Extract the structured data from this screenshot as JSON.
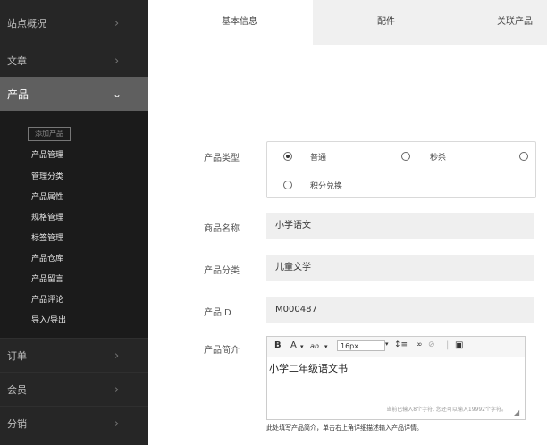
{
  "sidebar": {
    "top_items": [
      {
        "label": "站点概况",
        "icon": "chevron-right-icon"
      },
      {
        "label": "文章",
        "icon": "chevron-right-icon"
      }
    ],
    "active": {
      "label": "产品",
      "icon": "chevron-down-icon"
    },
    "sub_add": "添加产品",
    "sub_items": [
      "产品管理",
      "管理分类",
      "产品属性",
      "规格管理",
      "标签管理",
      "产品仓库",
      "产品留言",
      "产品评论",
      "导入/导出"
    ],
    "bottom_items": [
      {
        "label": "订单"
      },
      {
        "label": "会员"
      },
      {
        "label": "分销"
      }
    ],
    "chevron_right": "›",
    "chevron_down": "⌄"
  },
  "tabs": [
    {
      "label": "基本信息",
      "active": true
    },
    {
      "label": "配件",
      "active": false
    },
    {
      "label": "关联产品",
      "active": false
    }
  ],
  "form": {
    "type_label": "产品类型",
    "type_options": [
      {
        "label": "普通",
        "selected": true
      },
      {
        "label": "秒杀",
        "selected": false
      },
      {
        "label": "积分兑换",
        "selected": false
      }
    ],
    "name_label": "商品名称",
    "name_value": "小学语文",
    "category_label": "产品分类",
    "category_value": "儿童文学",
    "id_label": "产品ID",
    "id_value": "M000487",
    "desc_label": "产品简介",
    "editor": {
      "bold": "B",
      "font_color": "A",
      "highlight": "ab",
      "font_size": "16px",
      "line_height": "↕≡",
      "link": "∞",
      "unlink": "⊘",
      "image": "▣",
      "content": "小学二年级语文书",
      "counter": "当前已输入8个字符, 您还可以输入19992个字符。"
    },
    "hint": "此处填写产品简介，单击右上角详细描述输入产品详情。"
  }
}
